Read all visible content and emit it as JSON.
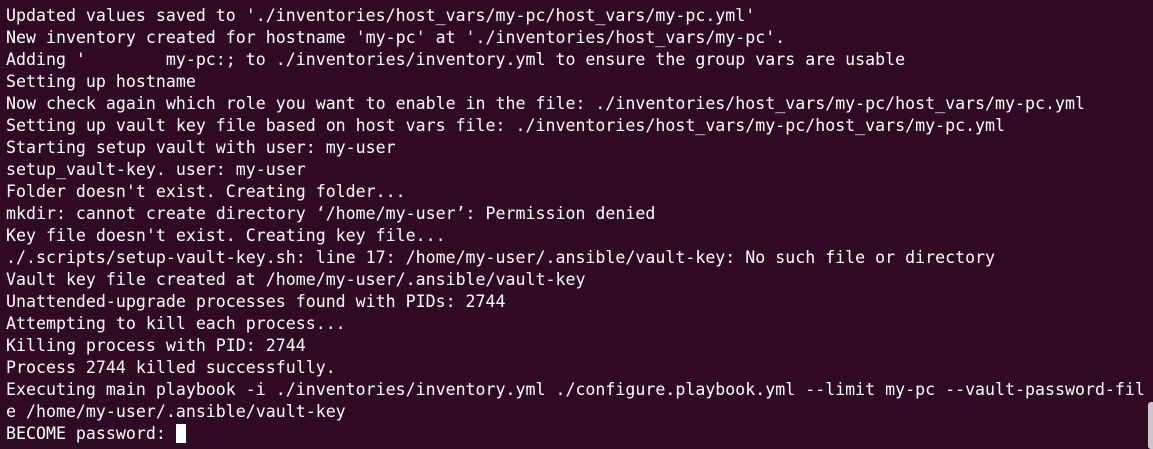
{
  "terminal": {
    "lines": [
      "Updated values saved to './inventories/host_vars/my-pc/host_vars/my-pc.yml'",
      "New inventory created for hostname 'my-pc' at './inventories/host_vars/my-pc'.",
      "Adding '        my-pc:; to ./inventories/inventory.yml to ensure the group vars are usable",
      "Setting up hostname",
      "Now check again which role you want to enable in the file: ./inventories/host_vars/my-pc/host_vars/my-pc.yml",
      "Setting up vault key file based on host vars file: ./inventories/host_vars/my-pc/host_vars/my-pc.yml",
      "Starting setup vault with user: my-user",
      "setup_vault-key. user: my-user",
      "Folder doesn't exist. Creating folder...",
      "mkdir: cannot create directory ‘/home/my-user’: Permission denied",
      "Key file doesn't exist. Creating key file...",
      "./.scripts/setup-vault-key.sh: line 17: /home/my-user/.ansible/vault-key: No such file or directory",
      "Vault key file created at /home/my-user/.ansible/vault-key",
      "Unattended-upgrade processes found with PIDs: 2744",
      "Attempting to kill each process...",
      "Killing process with PID: 2744",
      "Process 2744 killed successfully.",
      "Executing main playbook -i ./inventories/inventory.yml ./configure.playbook.yml --limit my-pc --vault-password-fil",
      "e /home/my-user/.ansible/vault-key"
    ],
    "prompt": "BECOME password: "
  },
  "colors": {
    "background": "#300a24",
    "text": "#ffffff"
  }
}
